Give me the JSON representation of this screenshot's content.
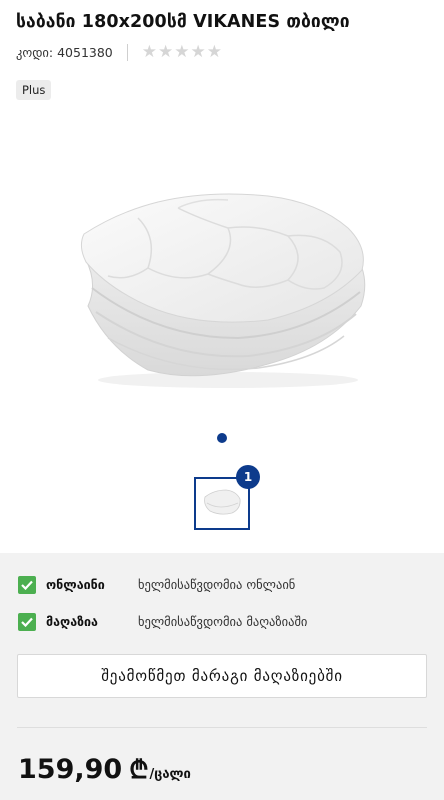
{
  "product": {
    "title": "საბანი 180x200სმ VIKANES თბილი",
    "code_label": "კოდი: 4051380",
    "rating_stars": 5,
    "rating_value": 0,
    "badge": "Plus"
  },
  "gallery": {
    "thumbnail_count": "1",
    "image_icon": "quilt-image-icon"
  },
  "availability": {
    "online_label": "ონლაინი",
    "online_status": "ხელმისაწვდომია ონლაინ",
    "store_label": "მაღაზია",
    "store_status": "ხელმისაწვდომია მაღაზიაში",
    "check_color": "#4caf50"
  },
  "stock_button": "შეამოწმეთ მარაგი მაღაზიებში",
  "price": {
    "amount": "159,90",
    "currency": "₾",
    "unit": "/ცალი"
  },
  "colors": {
    "accent": "#0d3b8c",
    "panel_bg": "#f2f2f2"
  }
}
